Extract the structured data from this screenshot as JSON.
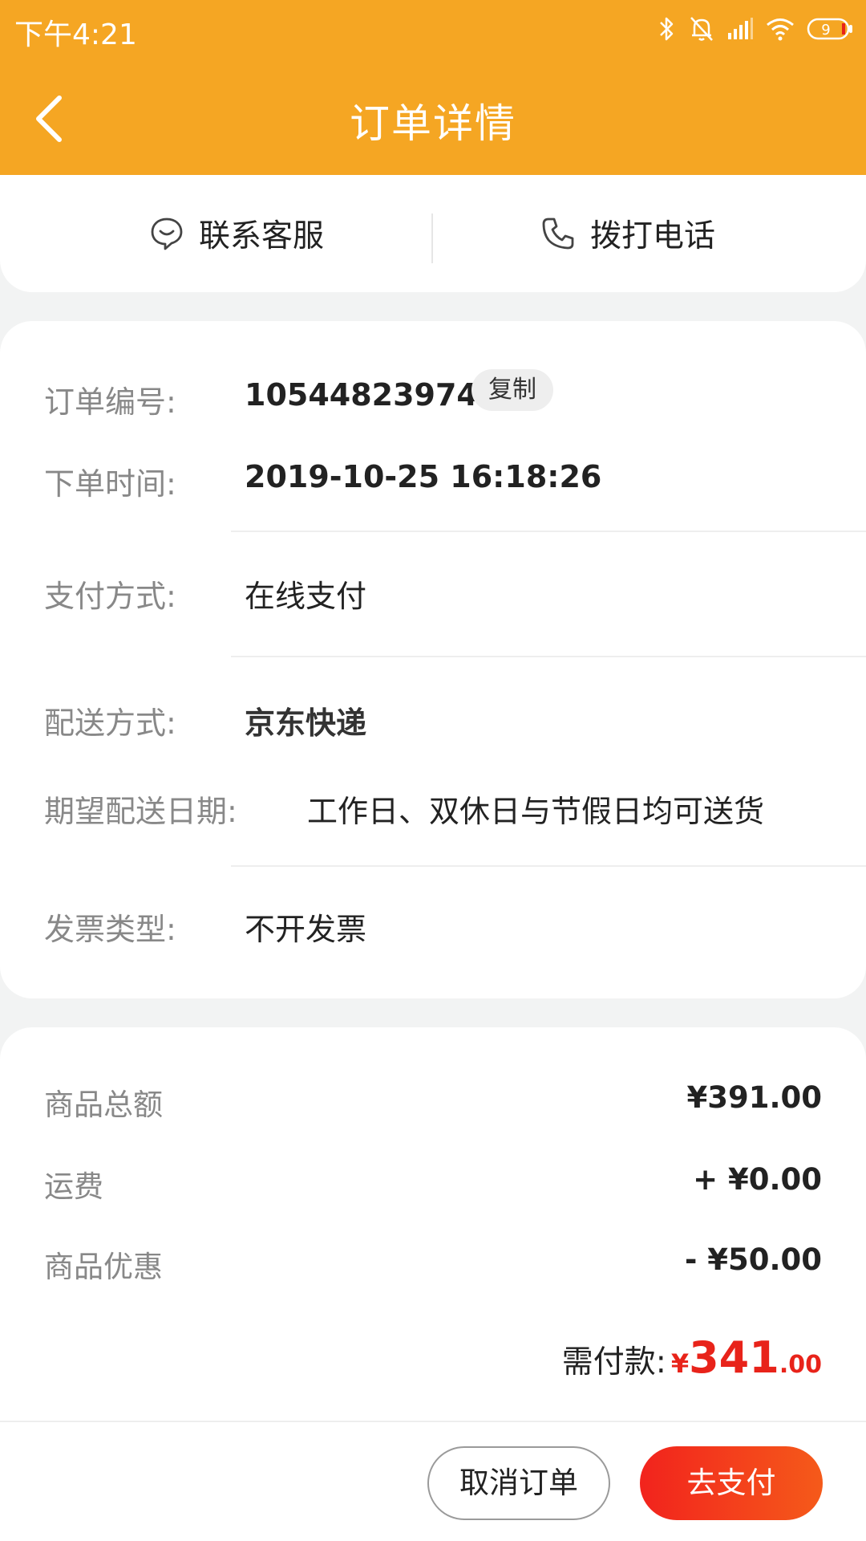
{
  "status_bar": {
    "time": "下午4:21",
    "battery": "9"
  },
  "header": {
    "title": "订单详情"
  },
  "contact": {
    "service_label": "联系客服",
    "call_label": "拨打电话"
  },
  "order_info": {
    "order_no_label": "订单编号:",
    "order_no": "105448239748",
    "copy_label": "复制",
    "order_time_label": "下单时间:",
    "order_time": "2019-10-25 16:18:26",
    "payment_label": "支付方式:",
    "payment": "在线支付",
    "delivery_label": "配送方式:",
    "delivery": "京东快递",
    "expected_date_label": "期望配送日期:",
    "expected_date": "工作日、双休日与节假日均可送货",
    "invoice_label": "发票类型:",
    "invoice": "不开发票"
  },
  "totals": {
    "goods_total_label": "商品总额",
    "goods_total": "¥391.00",
    "shipping_label": "运费",
    "shipping": "+ ¥0.00",
    "discount_label": "商品优惠",
    "discount": "- ¥50.00",
    "due_label": "需付款:",
    "due_currency": "¥",
    "due_integer": "341",
    "due_decimal": ".00"
  },
  "actions": {
    "cancel_label": "取消订单",
    "pay_label": "去支付"
  },
  "colors": {
    "header_bg": "#f5a623",
    "accent_red": "#e8231a"
  }
}
